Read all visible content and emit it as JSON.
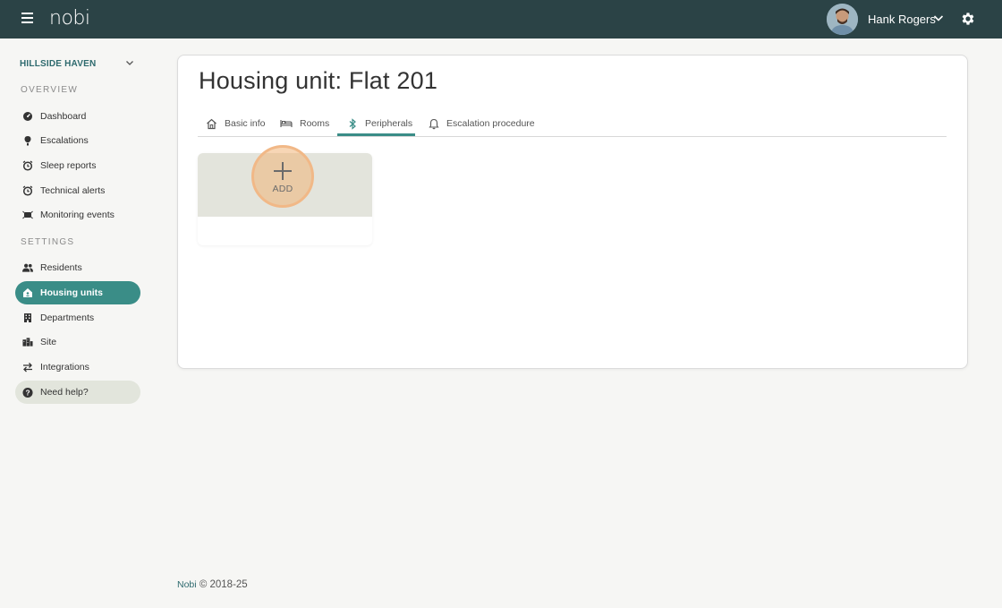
{
  "header": {
    "logo": "nobi",
    "user_name": "Hank Rogers",
    "colors": {
      "bar": "#2b4346"
    }
  },
  "sidebar": {
    "site_name": "HILLSIDE HAVEN",
    "overview_title": "OVERVIEW",
    "settings_title": "SETTINGS",
    "overview_items": [
      {
        "label": "Dashboard",
        "icon": "dashboard-icon"
      },
      {
        "label": "Escalations",
        "icon": "escalation-icon"
      },
      {
        "label": "Sleep reports",
        "icon": "alarm-clock-icon"
      },
      {
        "label": "Technical alerts",
        "icon": "alarm-clock-icon"
      },
      {
        "label": "Monitoring events",
        "icon": "monitoring-icon"
      }
    ],
    "settings_items": [
      {
        "label": "Residents",
        "icon": "people-icon"
      },
      {
        "label": "Housing units",
        "icon": "home-icon",
        "active": true
      },
      {
        "label": "Departments",
        "icon": "building-icon"
      },
      {
        "label": "Site",
        "icon": "city-icon"
      },
      {
        "label": "Integrations",
        "icon": "swap-arrows-icon"
      }
    ],
    "help_label": "Need help?",
    "accent_color": "#3a8d87"
  },
  "main": {
    "title": "Housing unit: Flat 201",
    "tabs": [
      {
        "label": "Basic info",
        "icon": "house-outline-icon"
      },
      {
        "label": "Rooms",
        "icon": "bed-icon"
      },
      {
        "label": "Peripherals",
        "icon": "bluetooth-icon",
        "active": true
      },
      {
        "label": "Escalation procedure",
        "icon": "bell-icon"
      }
    ],
    "add_label": "ADD"
  },
  "footer": {
    "brand": "Nobi",
    "copyright": "© 2018-25"
  }
}
